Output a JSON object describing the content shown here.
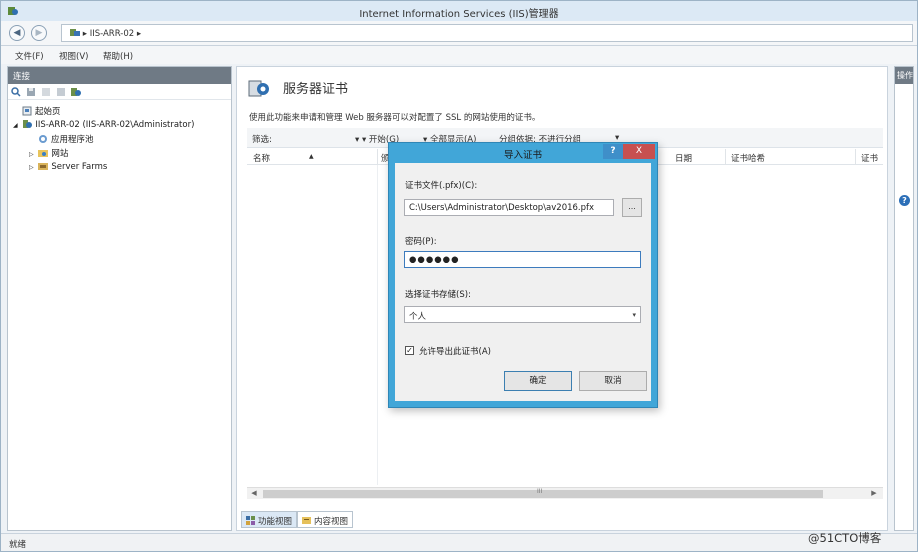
{
  "window": {
    "title": "Internet Information Services (IIS)管理器"
  },
  "addressbar": {
    "path_server": "IIS-ARR-02",
    "separator": "▸",
    "separator_end": "▸",
    "back": "◀",
    "forward": "▶"
  },
  "menu": {
    "file": "文件(F)",
    "view": "视图(V)",
    "help": "帮助(H)"
  },
  "connections": {
    "header": "连接",
    "tree": {
      "start_page": "起始页",
      "server": "IIS-ARR-02 (IIS-ARR-02\\Administrator)",
      "app_pools": "应用程序池",
      "sites": "网站",
      "server_farms": "Server Farms",
      "expand_open": "◢",
      "expand_closed": "▷"
    }
  },
  "main": {
    "title": "服务器证书",
    "description": "使用此功能来申请和管理 Web 服务器可以对配置了 SSL 的网站使用的证书。",
    "filter": {
      "label": "筛选:",
      "go": "▾ ▾ 开始(G)",
      "show_all": "▾ 全部显示(A)",
      "group_by": "分组依据: 不进行分组",
      "dropdown": "▾"
    },
    "columns": {
      "name": "名称",
      "date": "日期",
      "issued_by": "证书哈希",
      "last": "证书",
      "sort_indicator": "▲",
      "partial": "颁"
    },
    "scroll": {
      "left": "◀",
      "right": "▶",
      "thumb": "III"
    },
    "tabs": {
      "features": "功能视图",
      "content": "内容视图"
    }
  },
  "actions": {
    "header": "操作",
    "help": "?"
  },
  "status": {
    "text": "就绪"
  },
  "watermark": "@51CTO博客",
  "dialog": {
    "title": "导入证书",
    "help": "?",
    "close": "X",
    "cert_file_label": "证书文件(.pfx)(C):",
    "cert_file_value": "C:\\Users\\Administrator\\Desktop\\av2016.pfx",
    "browse": "...",
    "password_label": "密码(P):",
    "password_value": "●●●●●●",
    "store_label": "选择证书存储(S):",
    "store_value": "个人",
    "store_arrow": "▾",
    "allow_export": "允许导出此证书(A)",
    "allow_export_checked": true,
    "check_mark": "✓",
    "ok": "确定",
    "cancel": "取消"
  }
}
